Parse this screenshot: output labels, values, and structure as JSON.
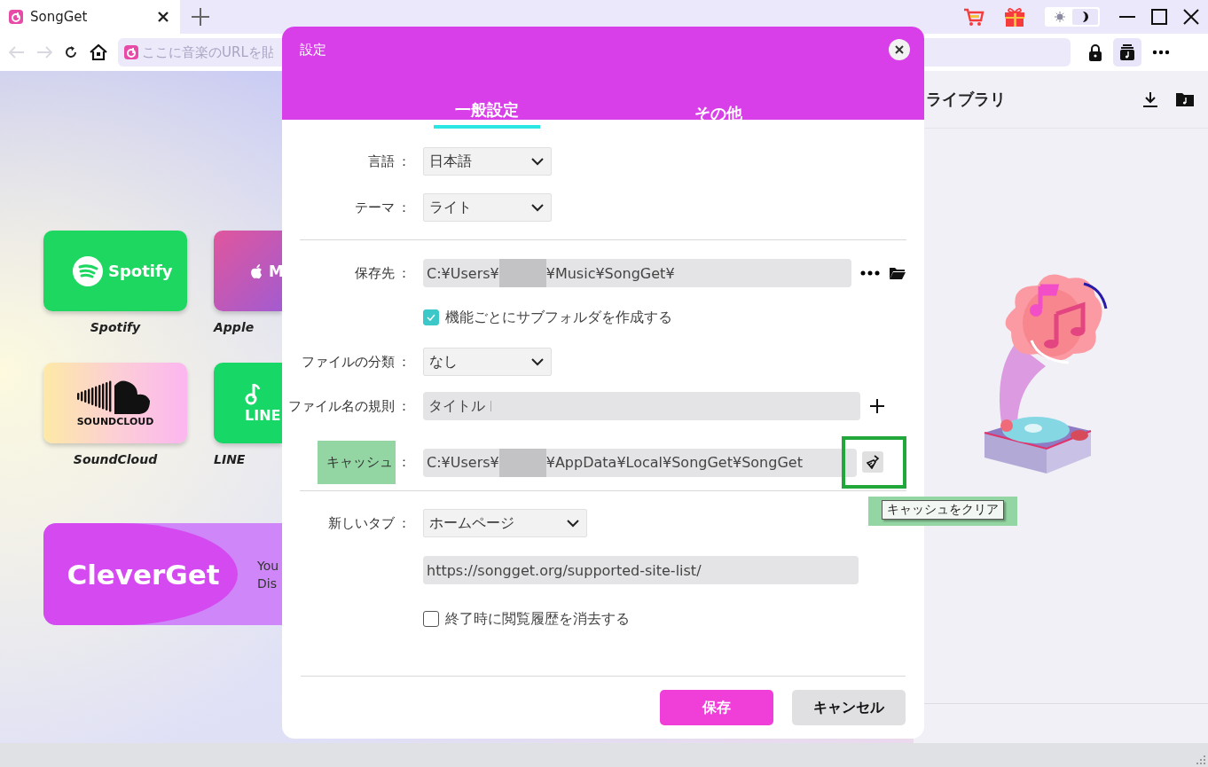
{
  "browser_tab": {
    "title": "SongGet"
  },
  "theme_toggle": [
    {
      "selected": false
    },
    {
      "selected": true
    }
  ],
  "nav": {
    "back_disabled": true,
    "forward_disabled": true
  },
  "address_bar": {
    "placeholder": "ここに音楽のURLを貼"
  },
  "library_button": {
    "selected": true
  },
  "services": [
    {
      "kind": "spotify",
      "logo_text": "Spotify",
      "label": "Spotify"
    },
    {
      "kind": "apple",
      "logo_text": "M",
      "label": "Apple"
    },
    {
      "kind": "soundcloud",
      "logo_text": "SOUNDCLOUD",
      "label": "SoundCloud"
    },
    {
      "kind": "line",
      "logo_text": "LINE",
      "label": "LINE"
    }
  ],
  "promo": {
    "brand": "CleverGet",
    "text_lines": [
      "You",
      "Dis"
    ]
  },
  "library": {
    "title": "ライブラリ"
  },
  "dialog": {
    "title": "設定",
    "tabs": [
      {
        "label": "一般設定",
        "selected": true
      },
      {
        "label": "その他",
        "selected": false
      }
    ],
    "sections": [
      {
        "rows": [
          {
            "kind": "select",
            "label": "言語",
            "colon": "：",
            "value": "日本語"
          },
          {
            "kind": "select",
            "label": "テーマ",
            "colon": "：",
            "value": "ライト"
          }
        ]
      },
      {
        "rows": [
          {
            "kind": "path",
            "label": "保存先",
            "colon": "：",
            "value_before": "C:¥Users¥",
            "value_after": "¥Music¥SongGet¥",
            "action": {
              "kind": "browse"
            }
          },
          {
            "kind": "checkbox",
            "checked": true,
            "text": "機能ごとにサブフォルダを作成する"
          },
          {
            "kind": "select",
            "label": "ファイルの分類",
            "colon": "：",
            "value": "なし"
          },
          {
            "kind": "tokens",
            "label": "ファイル名の規則",
            "colon": "：",
            "value": "タイトル"
          },
          {
            "kind": "path",
            "label": "キャッシュ",
            "colon": "：",
            "value_before": "C:¥Users¥",
            "value_after": "¥AppData¥Local¥SongGet¥SongGet",
            "action": {
              "kind": "clear"
            },
            "label_highlighted": true,
            "action_outlined": true,
            "tooltip": "キャッシュをクリア",
            "tooltip_highlighted": true
          }
        ]
      },
      {
        "rows": [
          {
            "kind": "select",
            "label": "新しいタブ",
            "colon": "：",
            "value": "ホームページ"
          },
          {
            "kind": "text",
            "value": "https://songget.org/supported-site-list/"
          },
          {
            "kind": "checkbox",
            "checked": false,
            "text": "終了時に閲覧履歴を消去する"
          }
        ]
      }
    ],
    "buttons": [
      {
        "kind": "primary",
        "label": "保存"
      },
      {
        "kind": "secondary",
        "label": "キャンセル"
      }
    ]
  }
}
